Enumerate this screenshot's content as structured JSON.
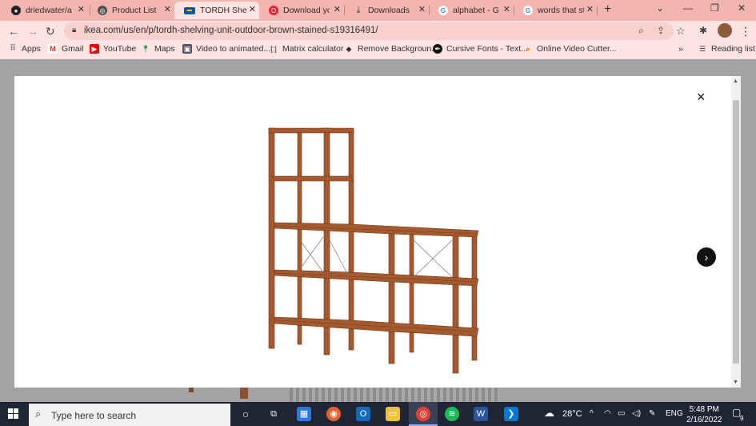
{
  "browser": {
    "tabs": [
      {
        "label": "driedwater/app",
        "favicon": "github-icon",
        "active": false
      },
      {
        "label": "Product List | C",
        "favicon": "globe-icon",
        "active": false
      },
      {
        "label": "TORDH Shelving",
        "favicon": "ikea-icon",
        "active": true
      },
      {
        "label": "Download you",
        "favicon": "opera-icon",
        "active": false
      },
      {
        "label": "Downloads",
        "favicon": "download-icon",
        "active": false
      },
      {
        "label": "alphabet - Goo",
        "favicon": "google-icon",
        "active": false
      },
      {
        "label": "words that star",
        "favicon": "google-icon",
        "active": false
      }
    ],
    "url": "ikea.com/us/en/p/tordh-shelving-unit-outdoor-brown-stained-s19316491/",
    "bookmarks": [
      {
        "label": "Apps",
        "icon": "apps-grid-icon"
      },
      {
        "label": "Gmail",
        "icon": "gmail-icon"
      },
      {
        "label": "YouTube",
        "icon": "youtube-icon"
      },
      {
        "label": "Maps",
        "icon": "maps-icon"
      },
      {
        "label": "Video to animated...",
        "icon": "video-icon"
      },
      {
        "label": "Matrix calculator",
        "icon": "matrix-icon"
      },
      {
        "label": "Remove Backgroun...",
        "icon": "remove-bg-icon"
      },
      {
        "label": "Cursive Fonts - Text...",
        "icon": "cursive-icon"
      },
      {
        "label": "Online Video Cutter...",
        "icon": "video-cutter-icon"
      }
    ],
    "more_bookmarks": "»",
    "reading_list": "Reading list"
  },
  "modal": {
    "close": "×",
    "next": "›",
    "image_icon": "shelving-unit-product-image"
  },
  "taskbar": {
    "search_placeholder": "Type here to search",
    "weather": "28°C",
    "language": "ENG",
    "time": "5:48 PM",
    "date": "2/16/2022",
    "notifications": "9"
  },
  "colors": {
    "chrome_bg": "#f7c9c6",
    "modal_bg": "#ffffff",
    "backdrop": "#a3a3a3",
    "taskbar": "#1f2535",
    "wood": "#a0562c"
  }
}
